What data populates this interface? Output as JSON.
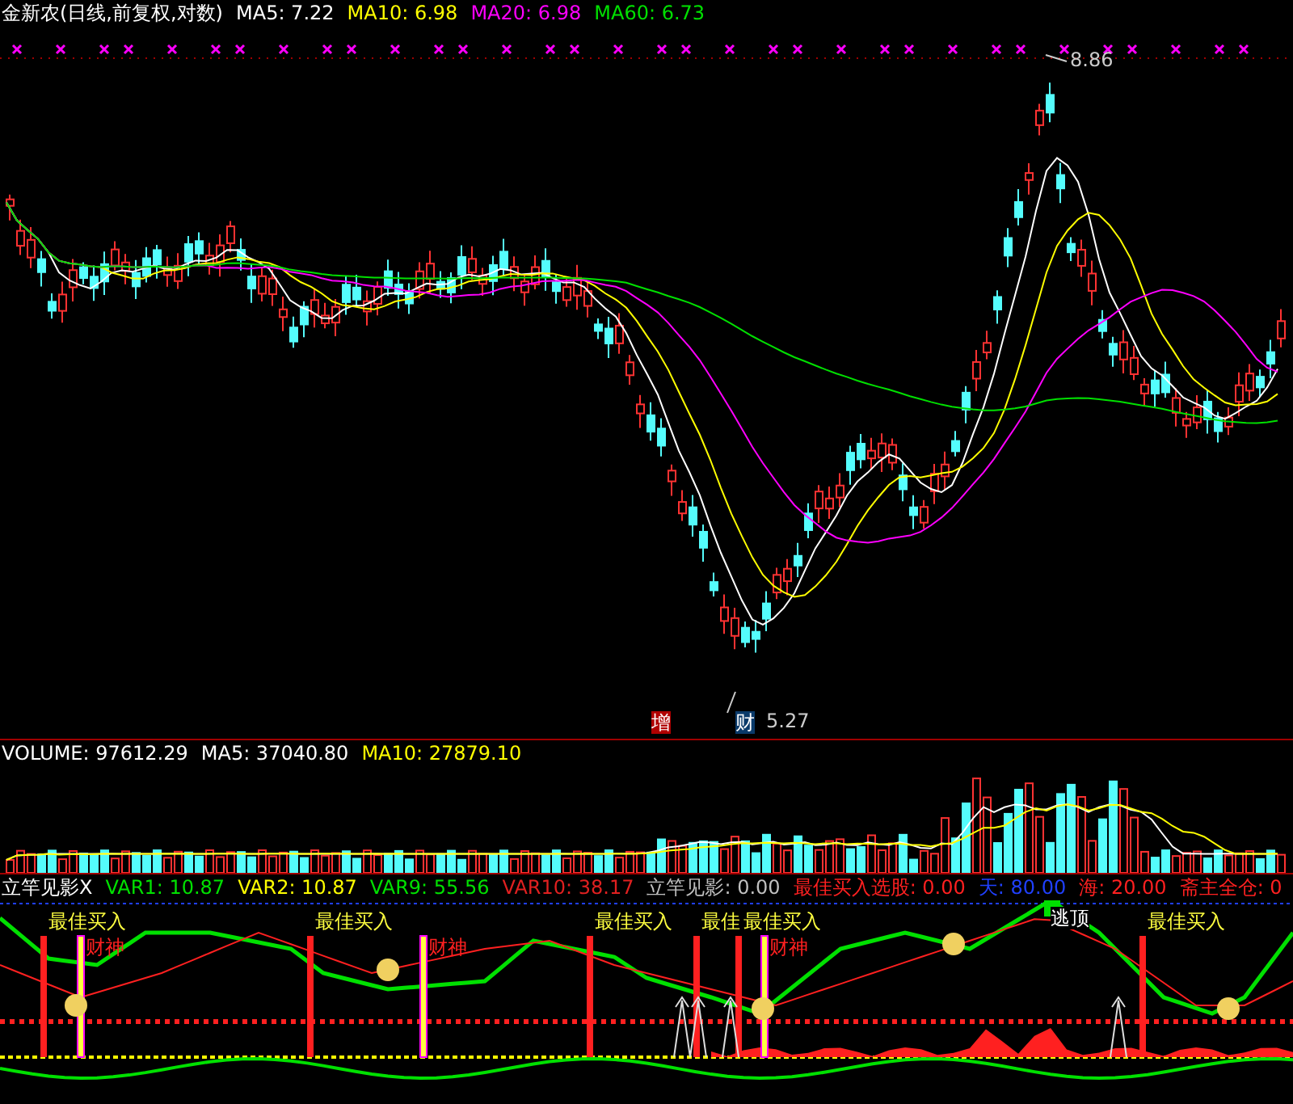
{
  "main_panel": {
    "title": "金新农(日线,前复权,对数)",
    "indicators": [
      {
        "label": "MA5: 7.22",
        "color": "#ffffff"
      },
      {
        "label": "MA10: 6.98",
        "color": "#ffff00"
      },
      {
        "label": "MA20: 6.98",
        "color": "#ff00ff"
      },
      {
        "label": "MA60: 6.73",
        "color": "#00e000"
      }
    ],
    "high_label": "8.86",
    "low_label": "5.27",
    "markers": [
      {
        "text": "增",
        "color": "#b00000"
      },
      {
        "text": "财",
        "color": "#0a3a6a"
      }
    ]
  },
  "volume_panel": {
    "indicators": [
      {
        "label": "VOLUME: 97612.29",
        "color": "#ffffff"
      },
      {
        "label": "MA5: 37040.80",
        "color": "#ffffff"
      },
      {
        "label": "MA10: 27879.10",
        "color": "#ffff00"
      }
    ]
  },
  "signal_panel": {
    "indicators": [
      {
        "label": "立竿见影X",
        "color": "#ffffff"
      },
      {
        "label": "VAR1: 10.87",
        "color": "#00e000"
      },
      {
        "label": "VAR2: 10.87",
        "color": "#ffff00"
      },
      {
        "label": "VAR9: 55.56",
        "color": "#00e000"
      },
      {
        "label": "VAR10: 38.17",
        "color": "#e02020"
      },
      {
        "label": "立竿见影: 0.00",
        "color": "#c0c0c0"
      },
      {
        "label": "最佳买入选股: 0.00",
        "color": "#ff2020"
      },
      {
        "label": "天: 80.00",
        "color": "#2040ff"
      },
      {
        "label": "海: 20.00",
        "color": "#ff2020"
      },
      {
        "label": "斋主全仓: 0",
        "color": "#ff2020"
      }
    ],
    "labels": [
      {
        "text": "最佳买入",
        "kind": "buy"
      },
      {
        "text": "财神",
        "kind": "god"
      },
      {
        "text": "最佳买入",
        "kind": "buy"
      },
      {
        "text": "财神",
        "kind": "god"
      },
      {
        "text": "最佳买入",
        "kind": "buy"
      },
      {
        "text": "最佳",
        "kind": "buy"
      },
      {
        "text": "最佳买入",
        "kind": "buy"
      },
      {
        "text": "财神",
        "kind": "god"
      },
      {
        "text": "逃顶",
        "kind": "top"
      },
      {
        "text": "最佳买入",
        "kind": "buy"
      }
    ]
  }
}
